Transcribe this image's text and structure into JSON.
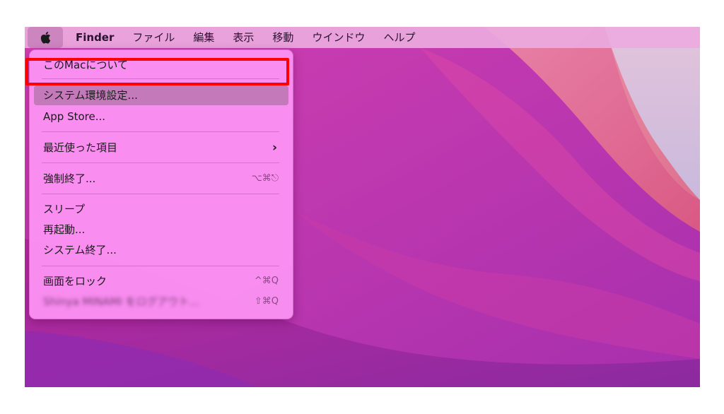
{
  "menubar": {
    "apple_icon": "apple-logo-icon",
    "items": [
      {
        "label": "Finder",
        "bold": true
      },
      {
        "label": "ファイル"
      },
      {
        "label": "編集"
      },
      {
        "label": "表示"
      },
      {
        "label": "移動"
      },
      {
        "label": "ウインドウ"
      },
      {
        "label": "ヘルプ"
      }
    ]
  },
  "apple_menu": {
    "items": {
      "about": {
        "label": "このMacについて"
      },
      "system_prefs": {
        "label": "システム環境設定...",
        "highlighted": true
      },
      "app_store": {
        "label": "App Store..."
      },
      "recent_items": {
        "label": "最近使った項目",
        "submenu_icon": "chevron-right-icon",
        "glyph": "›"
      },
      "force_quit": {
        "label": "強制終了...",
        "shortcut": "⌥⌘⎋"
      },
      "sleep": {
        "label": "スリープ"
      },
      "restart": {
        "label": "再起動..."
      },
      "shutdown": {
        "label": "システム終了..."
      },
      "lock_screen": {
        "label": "画面をロック",
        "shortcut": "^⌘Q"
      },
      "logout": {
        "label": "Shinya MINAMI をログアウト...",
        "shortcut": "⇧⌘Q",
        "blurred": true
      }
    }
  },
  "colors": {
    "highlight_box": "#ff0000",
    "menu_background": "#fb91f2",
    "wallpaper_primary": "#c72ea8"
  }
}
